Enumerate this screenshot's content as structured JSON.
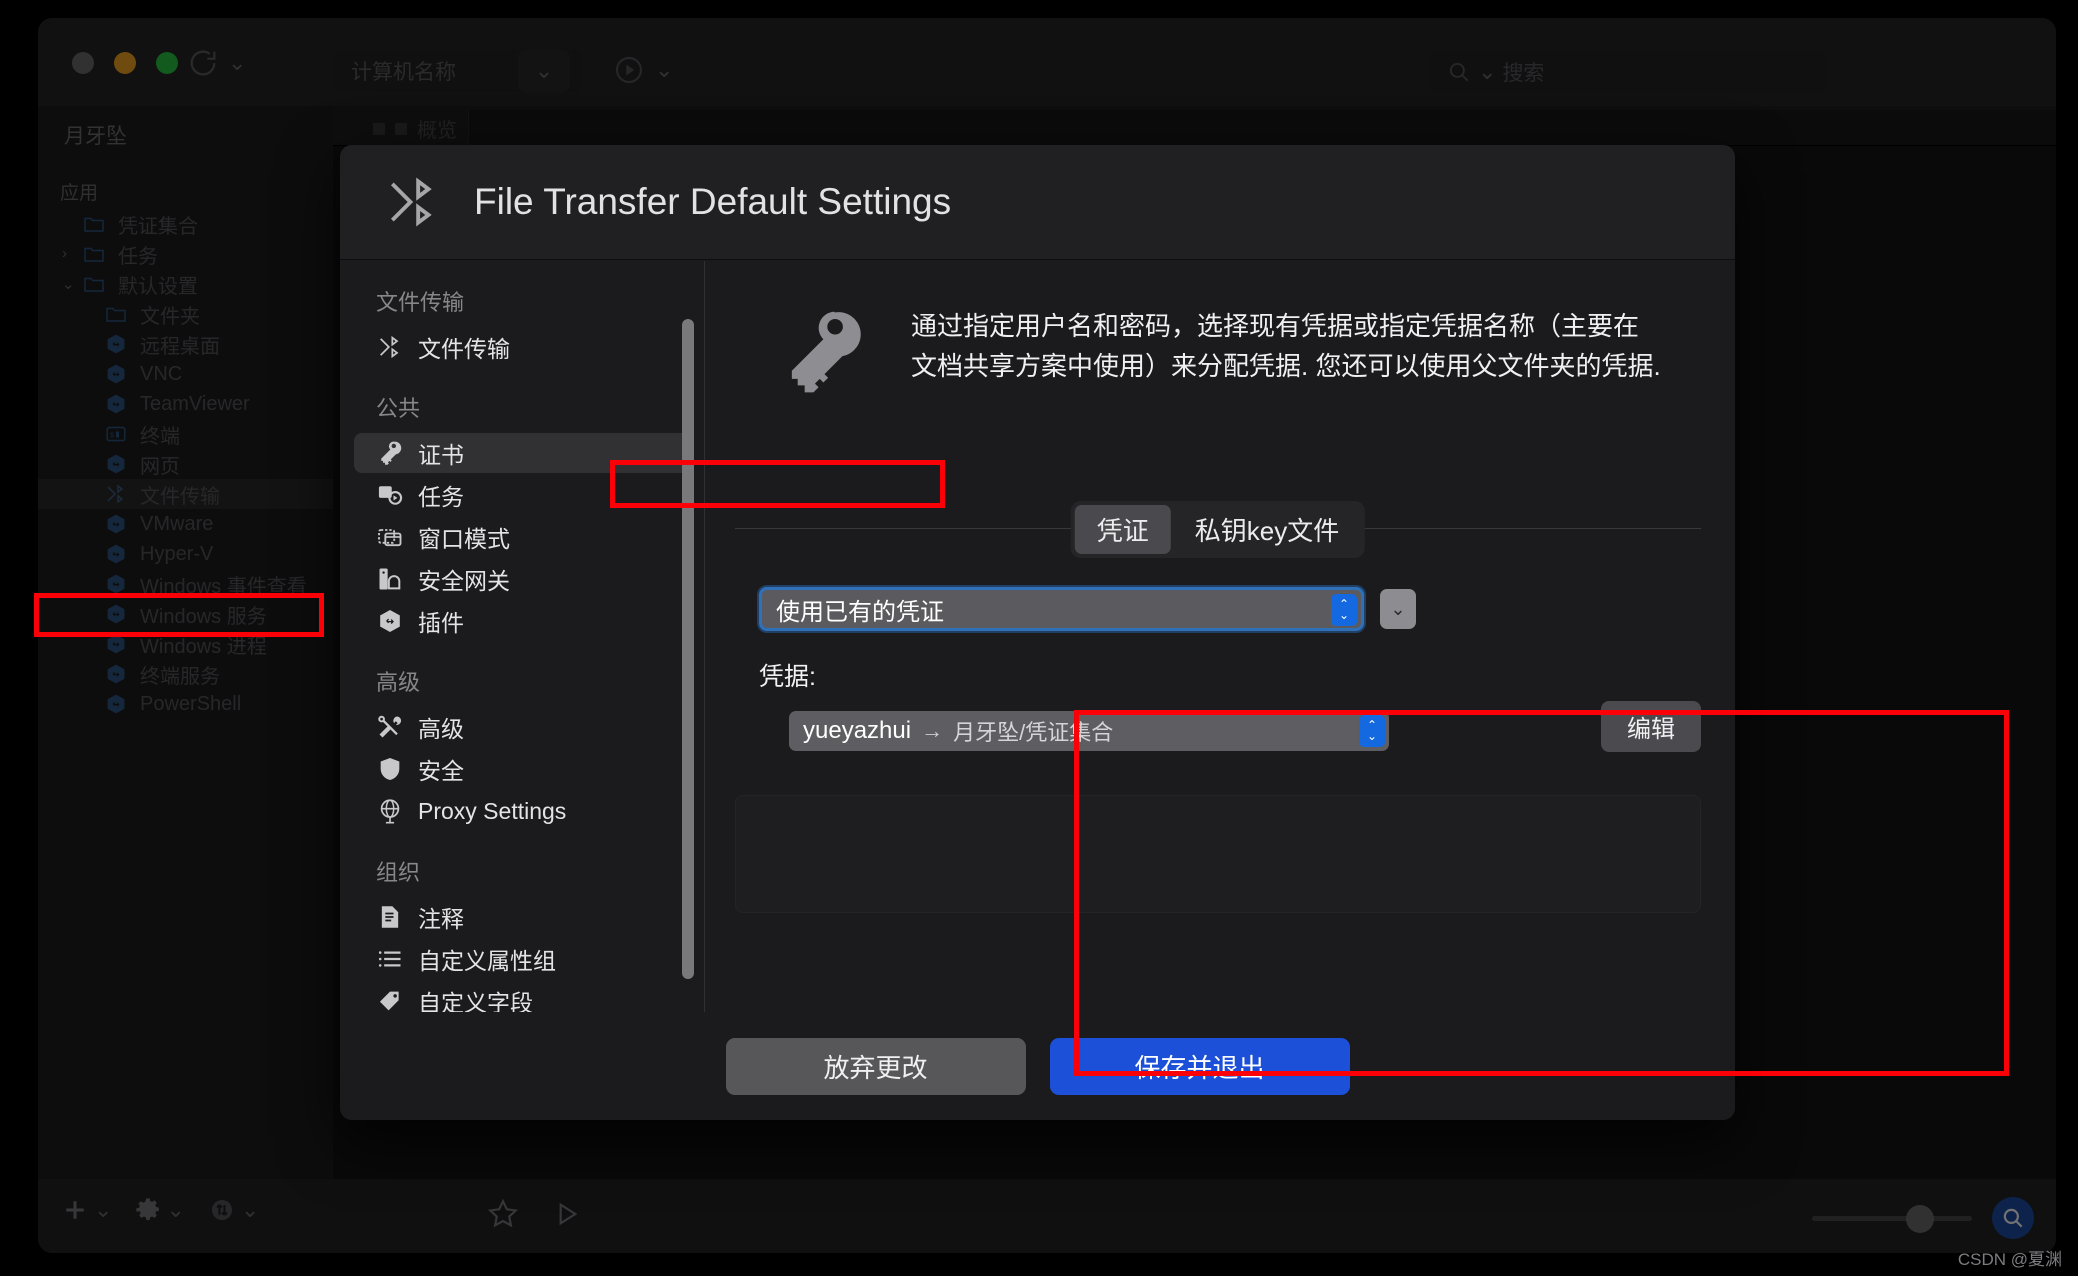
{
  "app": {
    "window_controls": [
      "close",
      "minimize",
      "maximize"
    ],
    "toolbar": {
      "computer_name_placeholder": "计算机名称",
      "search_placeholder": "搜索",
      "refresh_icon": "refresh-icon",
      "play_icon": "play-icon"
    },
    "sidebar": {
      "title": "月牙坠",
      "groups": [
        {
          "label": "应用",
          "items": [
            {
              "label": "凭证集合",
              "icon": "folder-icon",
              "level": 1,
              "twisty": "",
              "selected": false
            },
            {
              "label": "任务",
              "icon": "folder-icon",
              "level": 1,
              "twisty": "›",
              "selected": false
            },
            {
              "label": "默认设置",
              "icon": "folder-icon",
              "level": 1,
              "twisty": "⌄",
              "selected": false
            },
            {
              "label": "文件夹",
              "icon": "folder-icon",
              "level": 2,
              "twisty": "",
              "selected": false
            },
            {
              "label": "远程桌面",
              "icon": "cube-icon",
              "level": 2,
              "twisty": "",
              "selected": false
            },
            {
              "label": "VNC",
              "icon": "cube-icon",
              "level": 2,
              "twisty": "",
              "selected": false
            },
            {
              "label": "TeamViewer",
              "icon": "cube-icon",
              "level": 2,
              "twisty": "",
              "selected": false
            },
            {
              "label": "终端",
              "icon": "terminal-icon",
              "level": 2,
              "twisty": "",
              "selected": false
            },
            {
              "label": "网页",
              "icon": "cube-icon",
              "level": 2,
              "twisty": "",
              "selected": false
            },
            {
              "label": "文件传输",
              "icon": "file-transfer-icon",
              "level": 2,
              "twisty": "",
              "selected": true
            },
            {
              "label": "VMware",
              "icon": "cube-icon",
              "level": 2,
              "twisty": "",
              "selected": false
            },
            {
              "label": "Hyper-V",
              "icon": "cube-icon",
              "level": 2,
              "twisty": "",
              "selected": false
            },
            {
              "label": "Windows 事件查看",
              "icon": "cube-icon",
              "level": 2,
              "twisty": "",
              "selected": false
            },
            {
              "label": "Windows 服务",
              "icon": "cube-icon",
              "level": 2,
              "twisty": "",
              "selected": false
            },
            {
              "label": "Windows 进程",
              "icon": "cube-icon",
              "level": 2,
              "twisty": "",
              "selected": false
            },
            {
              "label": "终端服务",
              "icon": "cube-icon",
              "level": 2,
              "twisty": "",
              "selected": false
            },
            {
              "label": "PowerShell",
              "icon": "cube-icon",
              "level": 2,
              "twisty": "",
              "selected": false
            }
          ]
        }
      ]
    },
    "background_tab": "概览",
    "bottom_bar": {
      "add_label": "+",
      "gear_icon": "gear-icon",
      "transfer_icon": "transfer-icon",
      "favorite_icon": "star-icon",
      "run_icon": "play-triangle-icon",
      "zoom_icon": "zoom-search-icon"
    }
  },
  "dialog": {
    "title": "File Transfer Default Settings",
    "title_icon": "file-transfer-icon",
    "nav": [
      {
        "group": "文件传输",
        "items": [
          {
            "label": "文件传输",
            "icon": "file-transfer-icon",
            "selected": false
          }
        ]
      },
      {
        "group": "公共",
        "items": [
          {
            "label": "证书",
            "icon": "key-icon",
            "selected": true
          },
          {
            "label": "任务",
            "icon": "task-icon",
            "selected": false
          },
          {
            "label": "窗口模式",
            "icon": "window-icon",
            "selected": false
          },
          {
            "label": "安全网关",
            "icon": "gateway-icon",
            "selected": false
          },
          {
            "label": "插件",
            "icon": "cube-icon",
            "selected": false
          }
        ]
      },
      {
        "group": "高级",
        "items": [
          {
            "label": "高级",
            "icon": "tools-icon",
            "selected": false
          },
          {
            "label": "安全",
            "icon": "shield-icon",
            "selected": false
          },
          {
            "label": "Proxy Settings",
            "icon": "globe-icon",
            "selected": false
          }
        ]
      },
      {
        "group": "组织",
        "items": [
          {
            "label": "注释",
            "icon": "note-icon",
            "selected": false
          },
          {
            "label": "自定义属性组",
            "icon": "list-icon",
            "selected": false
          },
          {
            "label": "自定义字段",
            "icon": "tag-icon",
            "selected": false
          }
        ]
      }
    ],
    "description": "通过指定用户名和密码，选择现有凭据或指定凭据名称（主要在文档共享方案中使用）来分配凭据. 您还可以使用父文件夹的凭据.",
    "description_icon": "key-icon",
    "credential_panel": {
      "tabs": [
        {
          "label": "凭证",
          "active": true
        },
        {
          "label": "私钥key文件",
          "active": false
        }
      ],
      "mode_select_value": "使用已有的凭证",
      "credential_label": "凭据:",
      "credential_name": "yueyazhui",
      "credential_arrow": "→",
      "credential_path": "月牙坠/凭证集合",
      "edit_button": "编辑"
    },
    "footer": {
      "discard_label": "放弃更改",
      "save_label": "保存并退出"
    }
  },
  "annotations": {
    "highlight_color": "#fb0007",
    "boxes": [
      "sidebar-file-transfer",
      "nav-certificate",
      "credential-section"
    ]
  },
  "watermark": "CSDN @夏渊"
}
